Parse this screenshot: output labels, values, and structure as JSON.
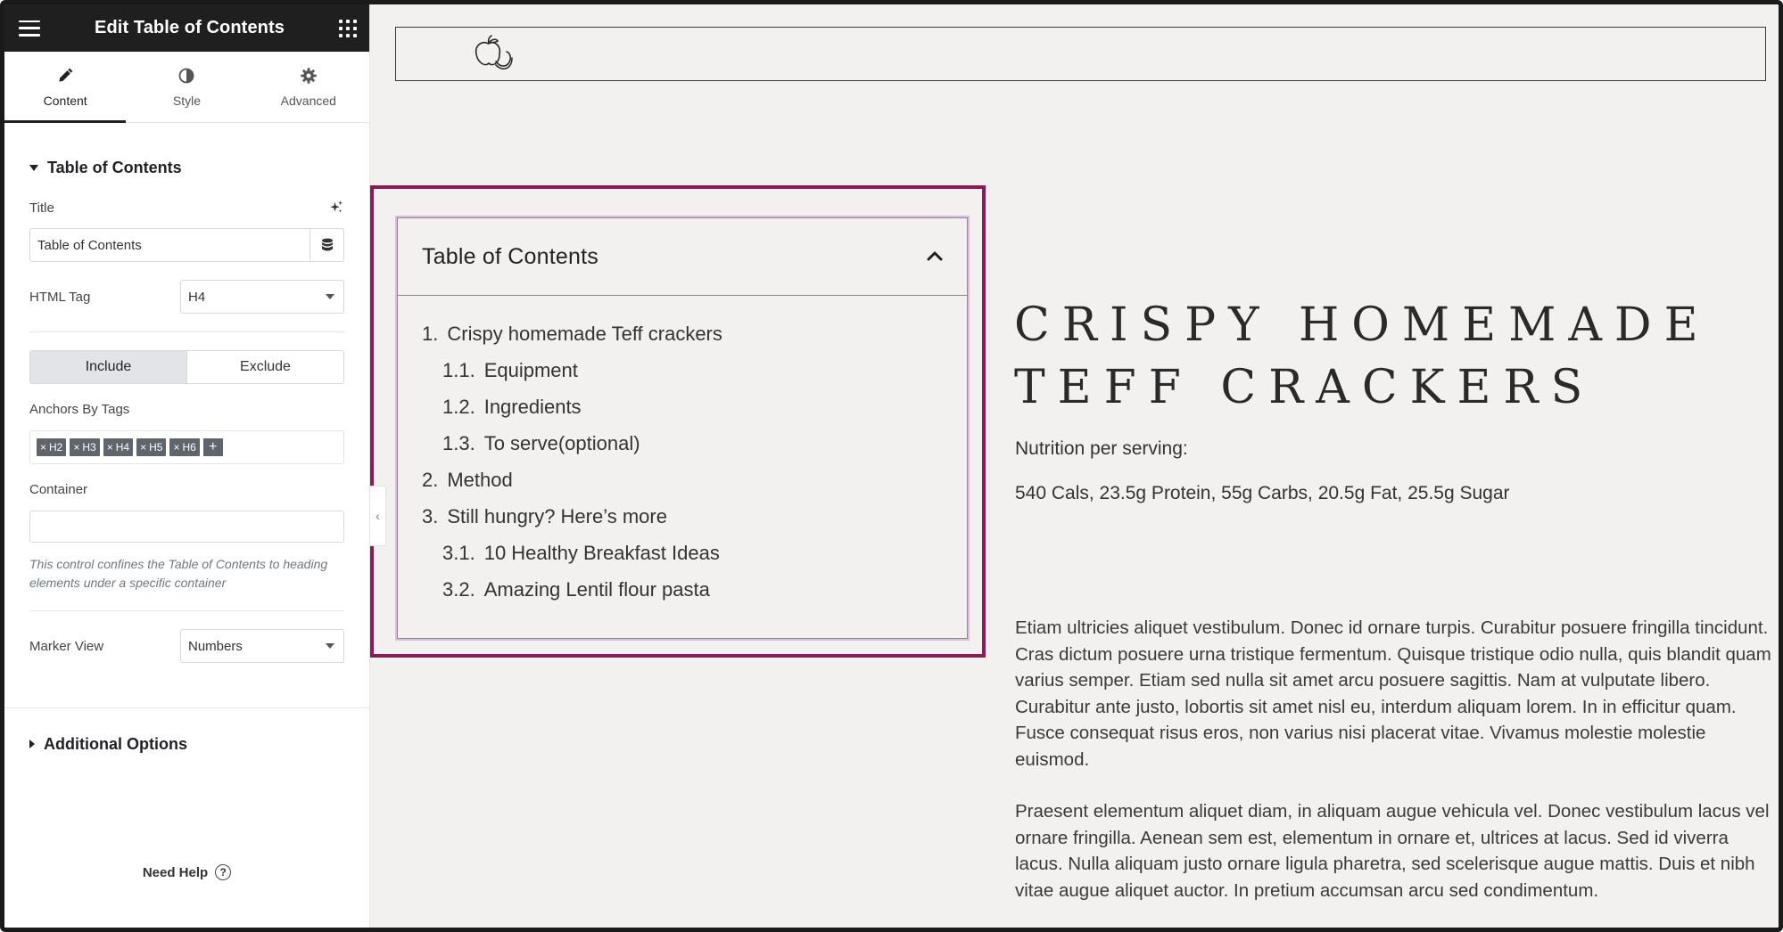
{
  "editor": {
    "title": "Edit Table of Contents",
    "tabs": [
      {
        "label": "Content",
        "icon": "pencil-icon",
        "active": true
      },
      {
        "label": "Style",
        "icon": "contrast-icon",
        "active": false
      },
      {
        "label": "Advanced",
        "icon": "gear-icon",
        "active": false
      }
    ],
    "section_title": "Table of Contents",
    "title_label": "Title",
    "title_value": "Table of Contents",
    "html_tag_label": "HTML Tag",
    "html_tag_value": "H4",
    "include_label": "Include",
    "exclude_label": "Exclude",
    "anchors_label": "Anchors By Tags",
    "anchor_tags": [
      "H2",
      "H3",
      "H4",
      "H5",
      "H6"
    ],
    "container_label": "Container",
    "container_value": "",
    "container_help": "This control confines the Table of Contents to heading elements under a specific container",
    "marker_view_label": "Marker View",
    "marker_view_value": "Numbers",
    "additional_options": "Additional Options",
    "need_help": "Need Help",
    "collapse_glyph": "‹"
  },
  "toc": {
    "title": "Table of Contents",
    "items": [
      {
        "num": "1.",
        "label": "Crispy homemade Teff crackers",
        "level": 1
      },
      {
        "num": "1.1.",
        "label": "Equipment",
        "level": 2
      },
      {
        "num": "1.2.",
        "label": "Ingredients",
        "level": 2
      },
      {
        "num": "1.3.",
        "label": "To serve(optional)",
        "level": 2
      },
      {
        "num": "2.",
        "label": "Method",
        "level": 1
      },
      {
        "num": "3.",
        "label": "Still hungry? Here’s more",
        "level": 1
      },
      {
        "num": "3.1.",
        "label": "10 Healthy Breakfast Ideas",
        "level": 2
      },
      {
        "num": "3.2.",
        "label": "Amazing Lentil flour pasta",
        "level": 2
      }
    ]
  },
  "recipe": {
    "title": "CRISPY HOMEMADE TEFF CRACKERS",
    "nutrition_label": "Nutrition per serving:",
    "nutrition_value": "540 Cals, 23.5g Protein, 55g Carbs, 20.5g Fat, 25.5g Sugar",
    "paragraph_1": "Etiam ultricies aliquet vestibulum. Donec id ornare turpis. Curabitur posuere fringilla tincidunt. Cras dictum posuere urna tristique fermentum. Quisque tristique odio nulla, quis blandit quam varius semper. Etiam sed nulla sit amet arcu posuere sagittis. Nam at vulputate libero. Curabitur ante justo, lobortis sit amet nisl eu, interdum aliquam lorem. In in efficitur quam. Fusce consequat risus eros, non varius nisi placerat vitae. Vivamus molestie molestie euismod.",
    "paragraph_2": "Praesent elementum aliquet diam, in aliquam augue vehicula vel. Donec vestibulum lacus vel ornare fringilla. Aenean sem est, elementum in ornare et, ultrices at lacus. Sed id viverra lacus. Nulla aliquam justo ornare ligula pharetra, sed scelerisque augue mattis. Duis et nibh vitae augue aliquet auctor. In pretium accumsan arcu sed condimentum."
  },
  "colors": {
    "selection_border": "#8b1a55",
    "widget_outline": "#e2b8e6",
    "topbar": "#1f1f1f",
    "canvas_bg": "#f2f1ef"
  }
}
